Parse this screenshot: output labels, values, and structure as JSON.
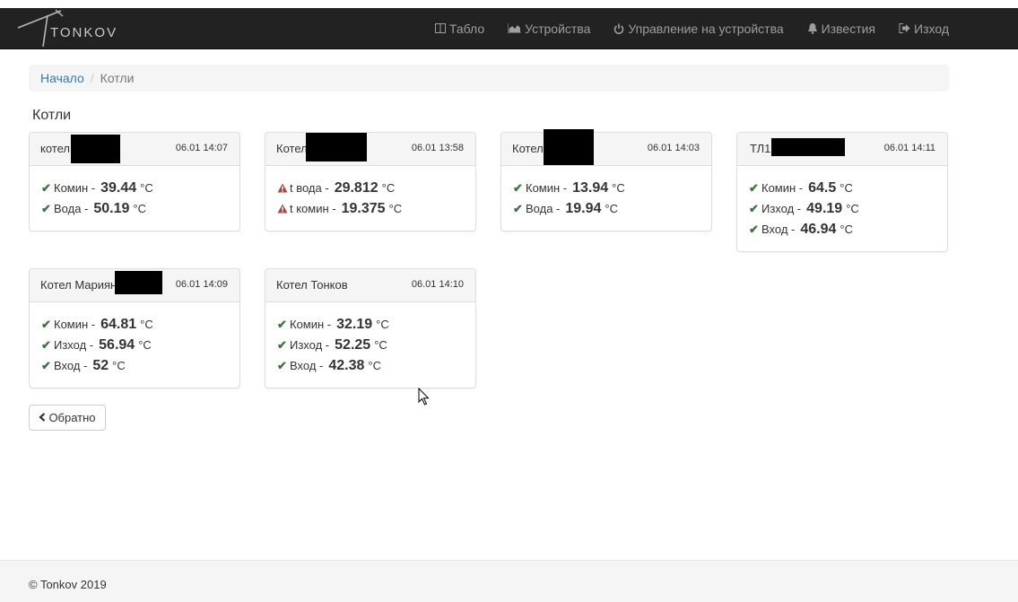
{
  "brand": {
    "name": "TONKOV"
  },
  "nav": [
    {
      "label": "Табло",
      "icon": "columns-icon"
    },
    {
      "label": "Устройства",
      "icon": "area-chart-icon"
    },
    {
      "label": "Управление на устройства",
      "icon": "power-icon"
    },
    {
      "label": "Известия",
      "icon": "bell-icon"
    },
    {
      "label": "Изход",
      "icon": "sign-out-icon"
    }
  ],
  "breadcrumb": {
    "home": "Начало",
    "separator": "/",
    "current": "Котли"
  },
  "page_title": "Котли",
  "colors": {
    "ok": "#3c763d",
    "warn": "#a94442",
    "navbar": "#222222",
    "link": "#337ab7"
  },
  "boilers": [
    {
      "name": "котел",
      "time": "06.01 14:07",
      "redacted": true,
      "readings": [
        {
          "status": "ok",
          "label": "Комин -",
          "value": "39.44",
          "unit": "°C"
        },
        {
          "status": "ok",
          "label": "Вода -",
          "value": "50.19",
          "unit": "°C"
        }
      ]
    },
    {
      "name": "Котел",
      "time": "06.01 13:58",
      "redacted": true,
      "readings": [
        {
          "status": "warn",
          "label": "t вода -",
          "value": "29.812",
          "unit": "°C"
        },
        {
          "status": "warn",
          "label": "t комин -",
          "value": "19.375",
          "unit": "°C"
        }
      ]
    },
    {
      "name": "Котел",
      "time": "06.01 14:03",
      "redacted": true,
      "readings": [
        {
          "status": "ok",
          "label": "Комин -",
          "value": "13.94",
          "unit": "°C"
        },
        {
          "status": "ok",
          "label": "Вода -",
          "value": "19.94",
          "unit": "°C"
        }
      ]
    },
    {
      "name": "ТЛ1",
      "time": "06.01 14:11",
      "redacted": true,
      "readings": [
        {
          "status": "ok",
          "label": "Комин -",
          "value": "64.5",
          "unit": "°C"
        },
        {
          "status": "ok",
          "label": "Изход -",
          "value": "49.19",
          "unit": "°C"
        },
        {
          "status": "ok",
          "label": "Вход -",
          "value": "46.94",
          "unit": "°C"
        }
      ]
    },
    {
      "name": "Котел Мариян",
      "time": "06.01 14:09",
      "redacted": true,
      "readings": [
        {
          "status": "ok",
          "label": "Комин -",
          "value": "64.81",
          "unit": "°C"
        },
        {
          "status": "ok",
          "label": "Изход -",
          "value": "56.94",
          "unit": "°C"
        },
        {
          "status": "ok",
          "label": "Вход -",
          "value": "52",
          "unit": "°C"
        }
      ]
    },
    {
      "name": "Котел Тонков",
      "time": "06.01 14:10",
      "redacted": false,
      "readings": [
        {
          "status": "ok",
          "label": "Комин -",
          "value": "32.19",
          "unit": "°C"
        },
        {
          "status": "ok",
          "label": "Изход -",
          "value": "52.25",
          "unit": "°C"
        },
        {
          "status": "ok",
          "label": "Вход -",
          "value": "42.38",
          "unit": "°C"
        }
      ]
    }
  ],
  "back_button": {
    "label": "Обратно"
  },
  "footer": {
    "text": "© Tonkov 2019"
  }
}
